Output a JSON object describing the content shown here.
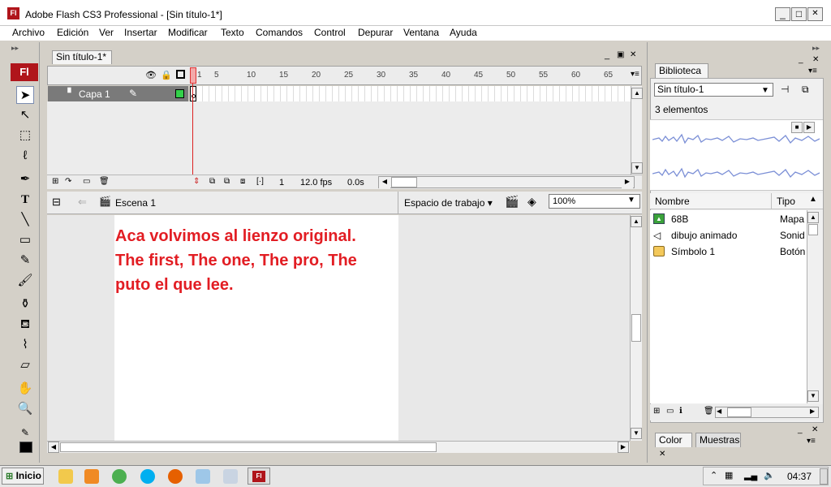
{
  "window": {
    "title": "Adobe Flash CS3 Professional - [Sin título-1*]",
    "app_icon": "Fl",
    "minimize": "_",
    "maximize": "□",
    "close": "✕"
  },
  "menubar": [
    "Archivo",
    "Edición",
    "Ver",
    "Insertar",
    "Modificar",
    "Texto",
    "Comandos",
    "Control",
    "Depurar",
    "Ventana",
    "Ayuda"
  ],
  "toolbox": {
    "logo": "Fl",
    "tools": [
      "selection-arrow-icon",
      "subselection-icon",
      "free-transform-icon",
      "lasso-icon",
      "pen-icon",
      "text-icon",
      "line-icon",
      "rectangle-icon",
      "pencil-icon",
      "brush-icon",
      "ink-bottle-icon",
      "paint-bucket-icon",
      "eyedropper-icon",
      "eraser-icon",
      "hand-icon",
      "zoom-icon",
      "stroke-color-icon",
      "fill-color-icon"
    ]
  },
  "document": {
    "tab": "Sin título-1*",
    "timeline": {
      "frame_numbers": [
        "1",
        "5",
        "10",
        "15",
        "20",
        "25",
        "30",
        "35",
        "40",
        "45",
        "50",
        "55",
        "60",
        "65"
      ],
      "layer_name": "Capa 1",
      "current_frame": "1",
      "fps": "12.0 fps",
      "time": "0.0s"
    },
    "scene": "Escena 1",
    "workspace": "Espacio de trabajo",
    "zoom": "100%",
    "stage_text": [
      "Aca volvimos al lienzo original.",
      "The first, The one, The pro, The",
      "puto el que lee."
    ],
    "text_color": "#e21d23"
  },
  "library": {
    "tab": "Biblioteca",
    "document_select": "Sin título-1",
    "count": "3 elementos",
    "col_name": "Nombre",
    "col_type": "Tipo",
    "items": [
      {
        "icon": "bitmap-icon",
        "name": "68B",
        "type": "Mapa"
      },
      {
        "icon": "sound-icon",
        "name": "dibujo animado",
        "type": "Sonid"
      },
      {
        "icon": "button-symbol-icon",
        "name": "Símbolo 1",
        "type": "Botón"
      }
    ]
  },
  "color_panel": {
    "tab_color": "Color",
    "tab_swatches": "Muestras"
  },
  "taskbar": {
    "start": "Inicio",
    "clock": "04:37"
  }
}
